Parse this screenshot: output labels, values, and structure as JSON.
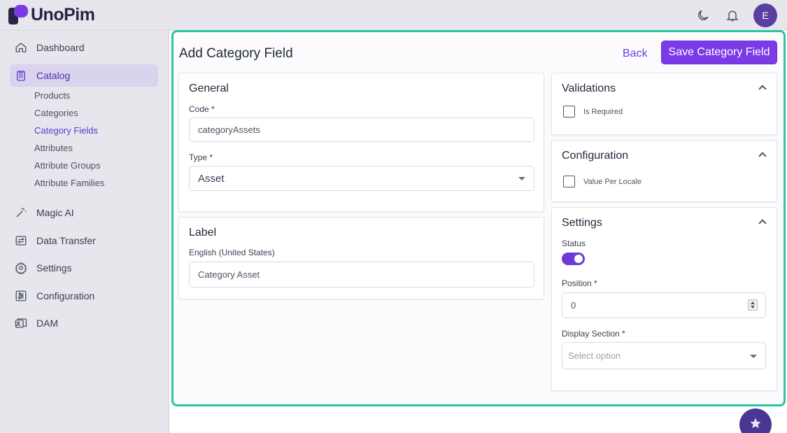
{
  "app": {
    "brand": "UnoPim",
    "avatar_initial": "E",
    "accent_color": "#7c3ae6",
    "highlight_color": "#2ec4a0"
  },
  "topbar": {
    "icons": [
      "moon-icon",
      "bell-icon"
    ]
  },
  "sidebar": {
    "items": [
      {
        "label": "Dashboard",
        "icon": "home-icon"
      },
      {
        "label": "Catalog",
        "icon": "clipboard-icon"
      },
      {
        "label": "Magic AI",
        "icon": "magic-wand-icon"
      },
      {
        "label": "Data Transfer",
        "icon": "transfer-icon"
      },
      {
        "label": "Settings",
        "icon": "gear-icon"
      },
      {
        "label": "Configuration",
        "icon": "sliders-icon"
      },
      {
        "label": "DAM",
        "icon": "images-icon"
      }
    ],
    "catalog_sub": [
      {
        "label": "Products"
      },
      {
        "label": "Categories"
      },
      {
        "label": "Category Fields"
      },
      {
        "label": "Attributes"
      },
      {
        "label": "Attribute Groups"
      },
      {
        "label": "Attribute Families"
      }
    ]
  },
  "modal": {
    "title": "Add Category Field",
    "back_label": "Back",
    "save_label": "Save Category Field"
  },
  "general": {
    "title": "General",
    "code_label": "Code *",
    "code_value": "categoryAssets",
    "type_label": "Type *",
    "type_value": "Asset"
  },
  "label_panel": {
    "title": "Label",
    "locale_label": "English (United States)",
    "locale_value": "Category Asset"
  },
  "validations": {
    "title": "Validations",
    "is_required_label": "Is Required"
  },
  "configuration": {
    "title": "Configuration",
    "value_per_locale_label": "Value Per Locale"
  },
  "settings": {
    "title": "Settings",
    "status_label": "Status",
    "status_on": true,
    "position_label": "Position *",
    "position_value": "0",
    "display_section_label": "Display Section *",
    "display_section_placeholder": "Select option"
  }
}
